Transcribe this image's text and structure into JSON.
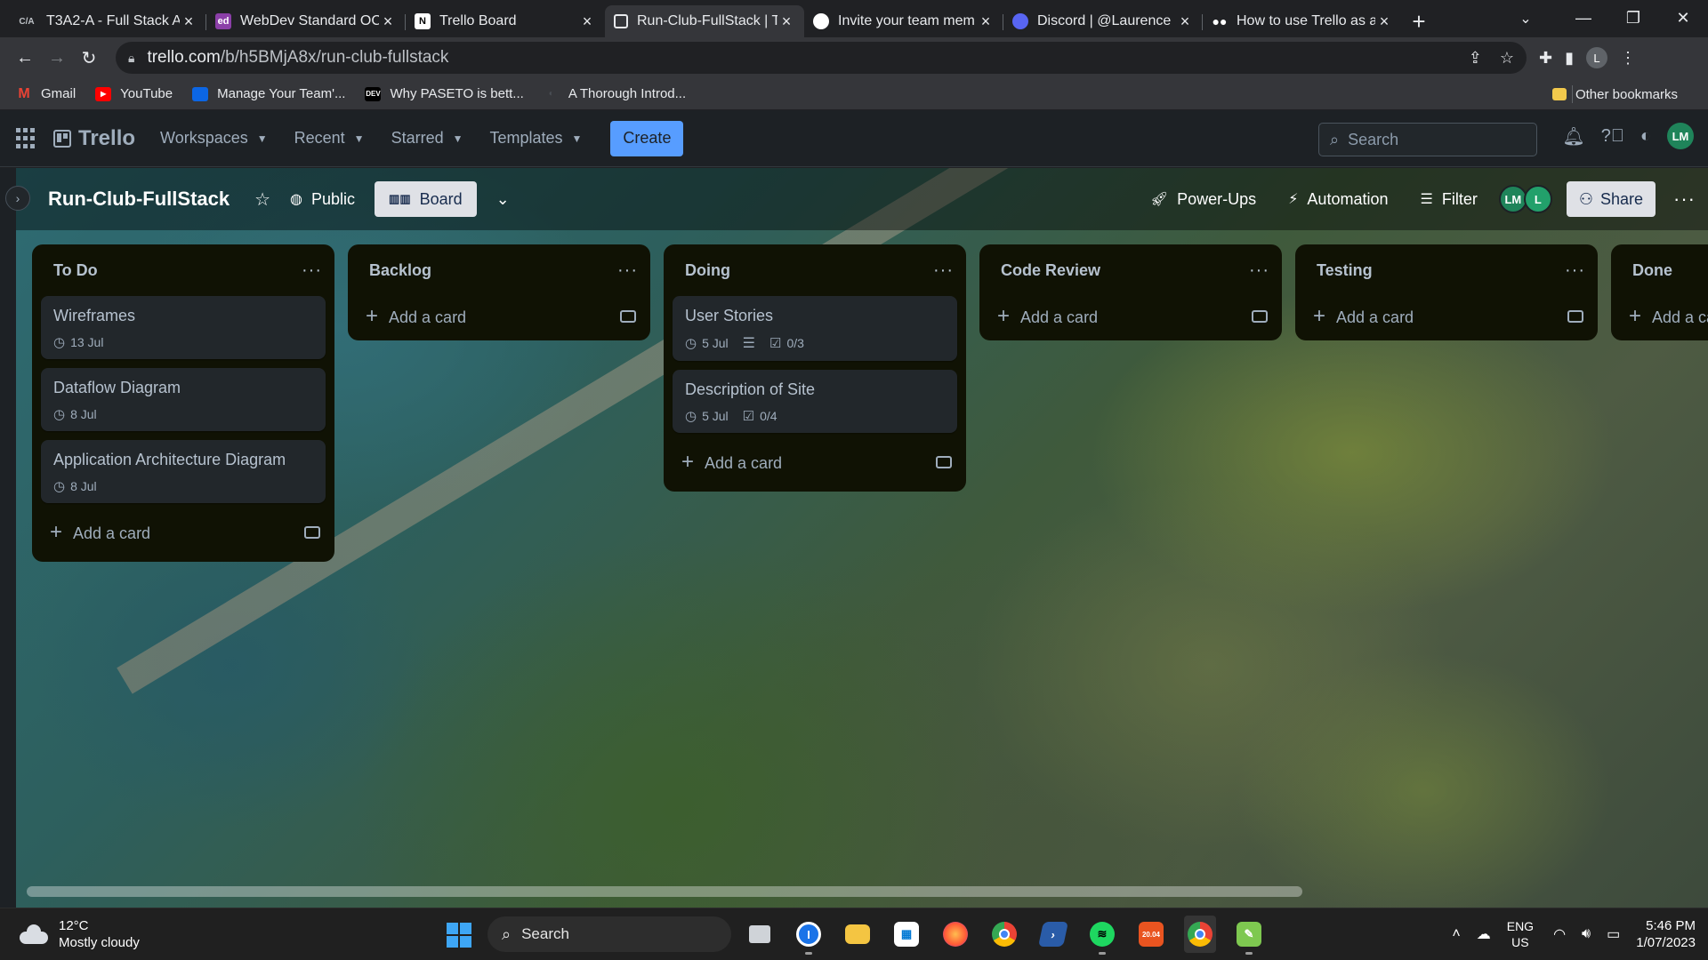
{
  "browser": {
    "tabs": [
      {
        "title": "T3A2-A - Full Stack Ap",
        "favicon": "C/A",
        "favicon_color": "#202124",
        "active": false
      },
      {
        "title": "WebDev Standard OC",
        "favicon": "ed",
        "favicon_color": "#8b3fa8",
        "active": false
      },
      {
        "title": "Trello Board",
        "favicon": "N",
        "favicon_color": "#ffffff",
        "active": false
      },
      {
        "title": "Run-Club-FullStack | T",
        "favicon": "trello-icon",
        "favicon_color": "#e8eaed",
        "active": true
      },
      {
        "title": "Invite your team mem",
        "favicon": "github-icon",
        "favicon_color": "#ffffff",
        "active": false
      },
      {
        "title": "Discord | @Laurence",
        "favicon": "discord-icon",
        "favicon_color": "#5865f2",
        "active": false
      },
      {
        "title": "How to use Trello as a",
        "favicon": "medium-icon",
        "favicon_color": "#ffffff",
        "active": false
      }
    ],
    "url_host": "trello.com",
    "url_path": "/b/h5BMjA8x/run-club-fullstack",
    "profile_initial": "L",
    "bookmarks": [
      {
        "label": "Gmail",
        "icon": "gmail-icon",
        "color": "#ea4335"
      },
      {
        "label": "YouTube",
        "icon": "youtube-icon",
        "color": "#ff0000"
      },
      {
        "label": "Manage Your Team'...",
        "icon": "trello-icon",
        "color": "#0c66e4"
      },
      {
        "label": "Why PASETO is bett...",
        "icon": "dev-icon",
        "color": "#000000"
      },
      {
        "label": "A Thorough Introd...",
        "icon": "site-icon",
        "color": "#35363a"
      }
    ],
    "other_bookmarks": "Other bookmarks"
  },
  "trello": {
    "logo": "Trello",
    "nav": [
      "Workspaces",
      "Recent",
      "Starred",
      "Templates"
    ],
    "create_label": "Create",
    "search_placeholder": "Search",
    "user_initials": "LM",
    "board": {
      "title": "Run-Club-FullStack",
      "visibility": "Public",
      "view": "Board",
      "power_ups": "Power-Ups",
      "automation": "Automation",
      "filter": "Filter",
      "members": [
        "LM",
        "L"
      ],
      "share": "Share"
    },
    "add_card_label": "Add a card",
    "lists": [
      {
        "title": "To Do",
        "cards": [
          {
            "title": "Wireframes",
            "due": "13 Jul"
          },
          {
            "title": "Dataflow Diagram",
            "due": "8 Jul"
          },
          {
            "title": "Application Architecture Diagram",
            "due": "8 Jul"
          }
        ]
      },
      {
        "title": "Backlog",
        "cards": []
      },
      {
        "title": "Doing",
        "cards": [
          {
            "title": "User Stories",
            "due": "5 Jul",
            "has_description": true,
            "checklist": "0/3"
          },
          {
            "title": "Description of Site",
            "due": "5 Jul",
            "checklist": "0/4"
          }
        ]
      },
      {
        "title": "Code Review",
        "cards": []
      },
      {
        "title": "Testing",
        "cards": []
      },
      {
        "title": "Done",
        "cards": []
      }
    ]
  },
  "taskbar": {
    "weather_temp": "12°C",
    "weather_desc": "Mostly cloudy",
    "search_label": "Search",
    "apps": [
      "task-view-icon",
      "1password-icon",
      "file-explorer-icon",
      "microsoft-store-icon",
      "firefox-icon",
      "chrome-icon",
      "powershell-icon",
      "spotify-icon",
      "ubuntu-icon",
      "chrome-profile-icon",
      "notepad-icon"
    ],
    "lang_top": "ENG",
    "lang_bottom": "US",
    "time": "5:46 PM",
    "date": "1/07/2023"
  }
}
